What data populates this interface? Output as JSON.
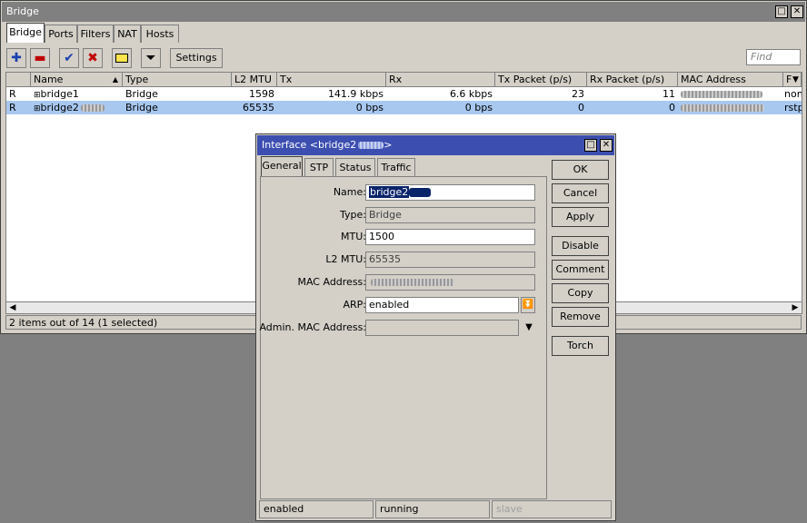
{
  "window": {
    "title": "Bridge",
    "tabs": [
      "Bridge",
      "Ports",
      "Filters",
      "NAT",
      "Hosts"
    ],
    "active_tab": "Bridge",
    "toolbar": {
      "settings_label": "Settings",
      "find_placeholder": "Find"
    },
    "columns": [
      "Name",
      "Type",
      "L2 MTU",
      "Tx",
      "Rx",
      "Tx Packet (p/s)",
      "Rx Packet (p/s)",
      "MAC Address",
      "F"
    ],
    "rows": [
      {
        "flag": "R",
        "name": "bridge1",
        "type": "Bridge",
        "l2mtu": "1598",
        "tx": "141.9 kbps",
        "rx": "6.6 kbps",
        "txp": "23",
        "rxp": "11",
        "extra": "none",
        "selected": false
      },
      {
        "flag": "R",
        "name": "bridge2",
        "type": "Bridge",
        "l2mtu": "65535",
        "tx": "0 bps",
        "rx": "0 bps",
        "txp": "0",
        "rxp": "0",
        "extra": "rstp",
        "selected": true
      }
    ],
    "status": "2 items out of 14 (1 selected)"
  },
  "dialog": {
    "title": "Interface <bridge2",
    "tabs": [
      "General",
      "STP",
      "Status",
      "Traffic"
    ],
    "active_tab": "General",
    "fields": {
      "name_label": "Name:",
      "name_value": "bridge2",
      "type_label": "Type:",
      "type_value": "Bridge",
      "mtu_label": "MTU:",
      "mtu_value": "1500",
      "l2mtu_label": "L2 MTU:",
      "l2mtu_value": "65535",
      "mac_label": "MAC Address:",
      "arp_label": "ARP:",
      "arp_value": "enabled",
      "admin_mac_label": "Admin. MAC Address:"
    },
    "buttons": [
      "OK",
      "Cancel",
      "Apply",
      "Disable",
      "Comment",
      "Copy",
      "Remove",
      "Torch"
    ],
    "status": [
      "enabled",
      "running",
      "slave"
    ]
  }
}
